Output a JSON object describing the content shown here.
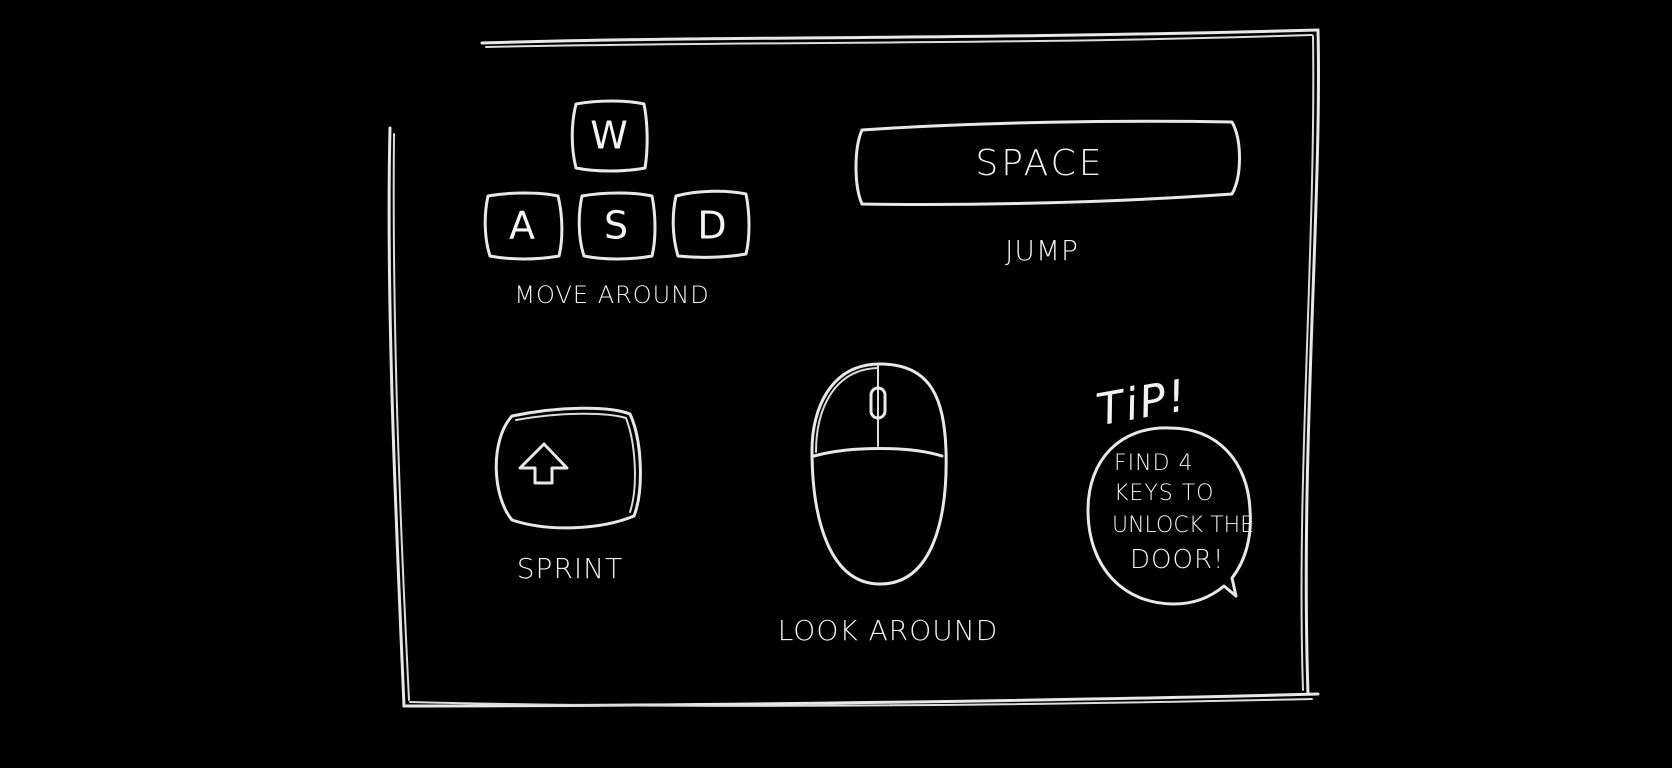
{
  "controls": {
    "move": {
      "keys": {
        "up": "W",
        "left": "A",
        "down": "S",
        "right": "D"
      },
      "label": "MOVE AROUND"
    },
    "jump": {
      "key": "SPACE",
      "label": "JUMP"
    },
    "sprint": {
      "icon": "shift-arrow-icon",
      "label": "SPRINT"
    },
    "look": {
      "icon": "mouse-icon",
      "label": "LOOK AROUND"
    }
  },
  "tip": {
    "heading": "TiP!",
    "lines": [
      "FIND 4",
      "KEYS TO",
      "UNLOCK THE",
      "DOOR!"
    ]
  },
  "colors": {
    "background": "#000000",
    "chalk": "#e8e8e8"
  }
}
